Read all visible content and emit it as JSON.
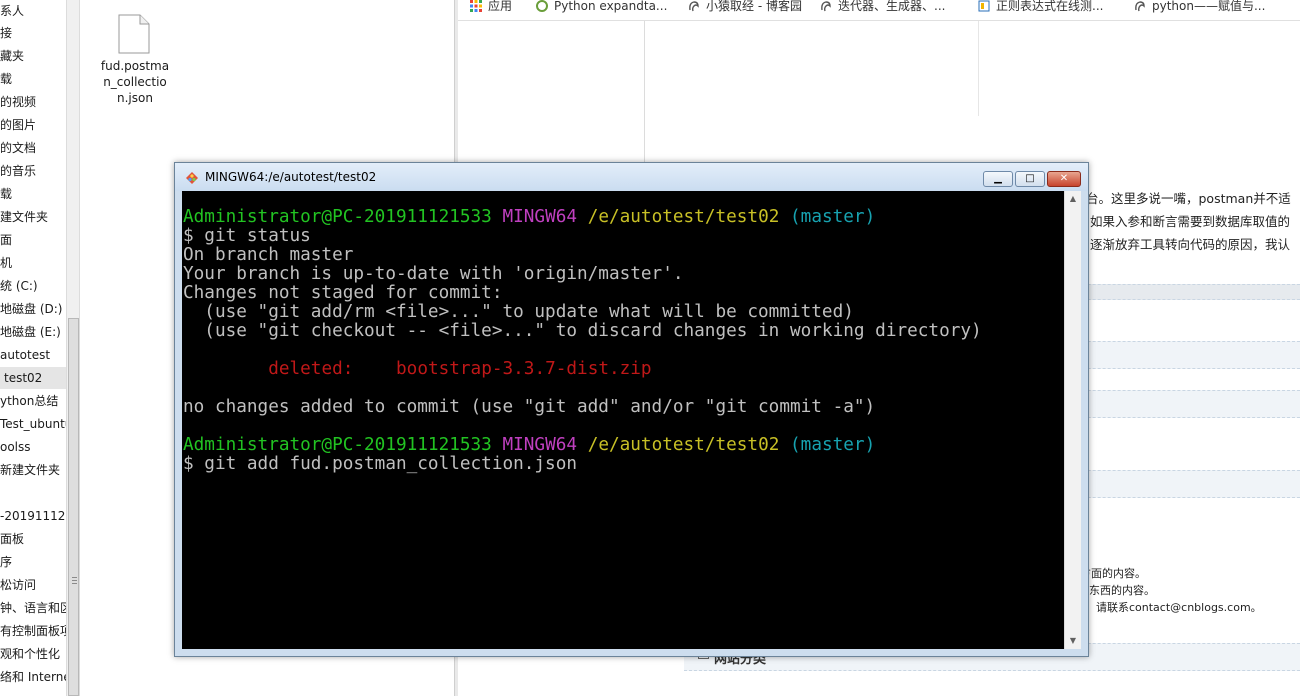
{
  "explorer": {
    "nav_items": [
      "系人",
      "接",
      "藏夹",
      "载",
      "的视频",
      "的图片",
      "的文档",
      "的音乐",
      "载",
      "建文件夹",
      "面",
      "机",
      "统 (C:)",
      "地磁盘 (D:)",
      "地磁盘 (E:)",
      "autotest",
      "test02",
      "ython总结",
      "Test_ubuntu",
      "oolss",
      "新建文件夹",
      "",
      "-20191112",
      "面板",
      "序",
      "松访问",
      "钟、语言和区",
      "有控制面板项",
      "观和个性化",
      "络和 Interne"
    ],
    "selected_item": "test02",
    "file": {
      "name": "fud.postman_collection.json",
      "icon": "file-icon"
    }
  },
  "browser": {
    "bookmarks": [
      {
        "label": "应用",
        "icon": "apps-grid-icon",
        "color": "#4285f4"
      },
      {
        "label": "Python expandta...",
        "icon": "python-site-icon",
        "color": "#6a9e3a"
      },
      {
        "label": "小猿取经 - 博客园",
        "icon": "cnblogs-icon",
        "color": "#555555"
      },
      {
        "label": "迭代器、生成器、...",
        "icon": "cnblogs-icon",
        "color": "#555555"
      },
      {
        "label": "正则表达式在线测...",
        "icon": "regex-site-icon",
        "color": "#2a6fb8"
      },
      {
        "label": "python——赋值与...",
        "icon": "cnblogs-icon",
        "color": "#555555"
      }
    ],
    "article_lines": [
      "台。这里多说一嘴，postman并不适",
      "如果入参和断言需要到数据库取值的",
      "逐渐放弃工具转向代码的原因，我认"
    ],
    "footer_lines": [
      "方面的内容。",
      "列东西的内容。",
      "问，请联系contact@cnblogs.com。"
    ],
    "panel_heading": "网站分类"
  },
  "terminal": {
    "window_title": "MINGW64:/e/autotest/test02",
    "prompt": {
      "user": "Administrator@PC-201911121533",
      "shell": "MINGW64",
      "path": "/e/autotest/test02",
      "branch": "(master)"
    },
    "command1": "$ git status",
    "output": [
      "On branch master",
      "Your branch is up-to-date with 'origin/master'.",
      "Changes not staged for commit:",
      "  (use \"git add/rm <file>...\" to update what will be committed)",
      "  (use \"git checkout -- <file>...\" to discard changes in working directory)"
    ],
    "deleted_label": "deleted:",
    "deleted_file": "bootstrap-3.3.7-dist.zip",
    "summary": "no changes added to commit (use \"git add\" and/or \"git commit -a\")",
    "command2": "$ git add fud.postman_collection.json",
    "buttons": {
      "minimize": "▁",
      "maximize": "□",
      "close": "✕"
    }
  }
}
